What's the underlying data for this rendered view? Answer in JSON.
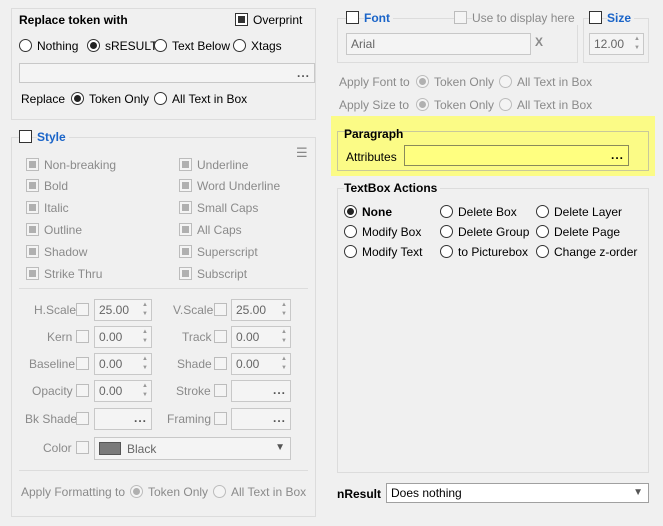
{
  "replace_token": {
    "title": "Replace token with",
    "overprint_label": "Overprint",
    "options": [
      "Nothing",
      "sRESULT",
      "Text Below",
      "Xtags"
    ],
    "selected": "sRESULT",
    "dots": "...",
    "replace_label": "Replace",
    "replace_options": [
      "Token Only",
      "All Text in Box"
    ],
    "replace_selected": "Token Only"
  },
  "style": {
    "title": "Style",
    "left_options": [
      "Non-breaking",
      "Bold",
      "Italic",
      "Outline",
      "Shadow",
      "Strike Thru"
    ],
    "right_options": [
      "Underline",
      "Word Underline",
      "Small Caps",
      "All Caps",
      "Superscript",
      "Subscript"
    ],
    "hscale_label": "H.Scale",
    "hscale_value": "25.00",
    "vscale_label": "V.Scale",
    "vscale_value": "25.00",
    "kern_label": "Kern",
    "kern_value": "0.00",
    "track_label": "Track",
    "track_value": "0.00",
    "baseline_label": "Baseline",
    "baseline_value": "0.00",
    "shade_label": "Shade",
    "shade_value": "0.00",
    "opacity_label": "Opacity",
    "opacity_value": "0.00",
    "stroke_label": "Stroke",
    "bkshade_label": "Bk Shade",
    "framing_label": "Framing",
    "color_label": "Color",
    "color_value": "Black",
    "apply_label": "Apply Formatting to",
    "apply_options": [
      "Token Only",
      "All Text in Box"
    ],
    "dots": "..."
  },
  "font": {
    "title": "Font",
    "use_display_label": "Use to display here",
    "font_value": "Arial",
    "clear_label": "X",
    "size_title": "Size",
    "size_value": "12.00",
    "apply_font_label": "Apply Font to",
    "apply_size_label": "Apply Size to",
    "apply_options": [
      "Token Only",
      "All Text in Box"
    ]
  },
  "paragraph": {
    "title": "Paragraph",
    "attributes_label": "Attributes",
    "dots": "...",
    "highlight_color": "#ffff80"
  },
  "textbox": {
    "title": "TextBox Actions",
    "col1": [
      "None",
      "Modify Box",
      "Modify Text"
    ],
    "col2": [
      "Delete Box",
      "Delete Group",
      "to Picturebox"
    ],
    "col3": [
      "Delete Layer",
      "Delete Page",
      "Change z-order"
    ],
    "selected": "None"
  },
  "nresult": {
    "label": "nResult",
    "value": "Does nothing"
  }
}
